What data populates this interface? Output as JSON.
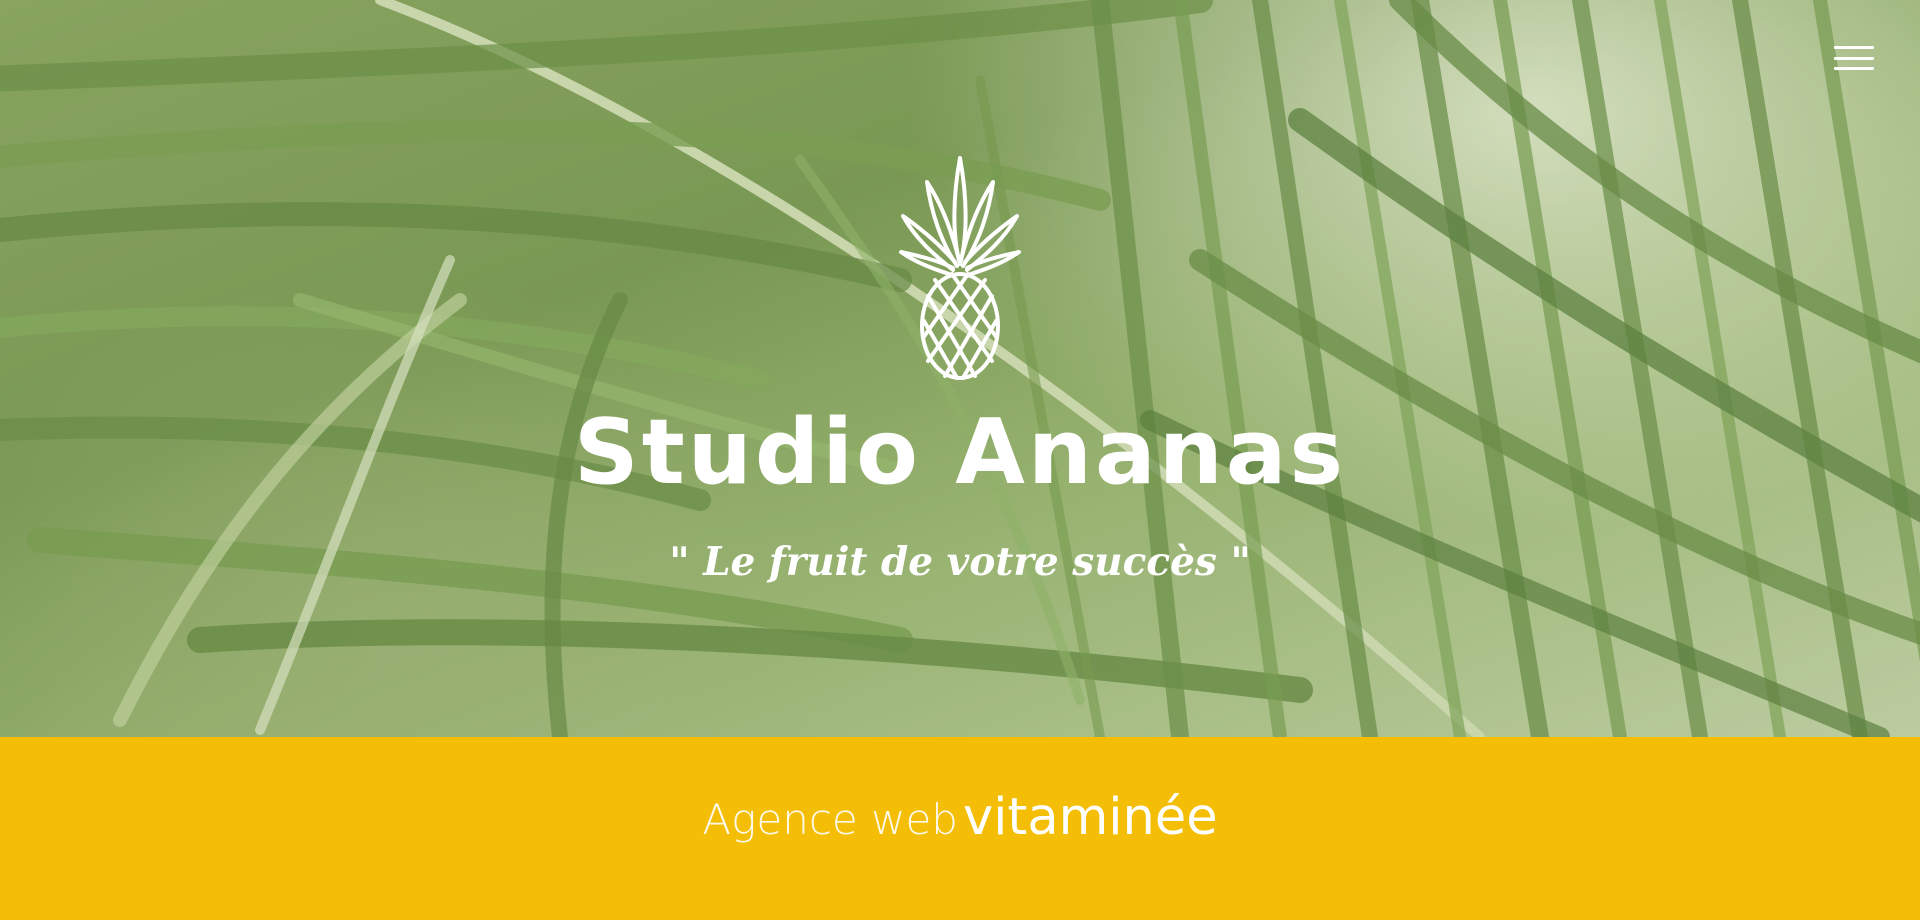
{
  "hero": {
    "brand": "Studio Ananas",
    "tagline": "\" Le fruit de votre succès \"",
    "logo_icon": "pineapple-icon",
    "menu_icon": "hamburger-menu-icon"
  },
  "band": {
    "light_text": "Agence web",
    "strong_text": "vitaminée"
  },
  "colors": {
    "accent_yellow": "#f5be06",
    "foliage_green": "#6e8f45",
    "text": "#ffffff"
  }
}
